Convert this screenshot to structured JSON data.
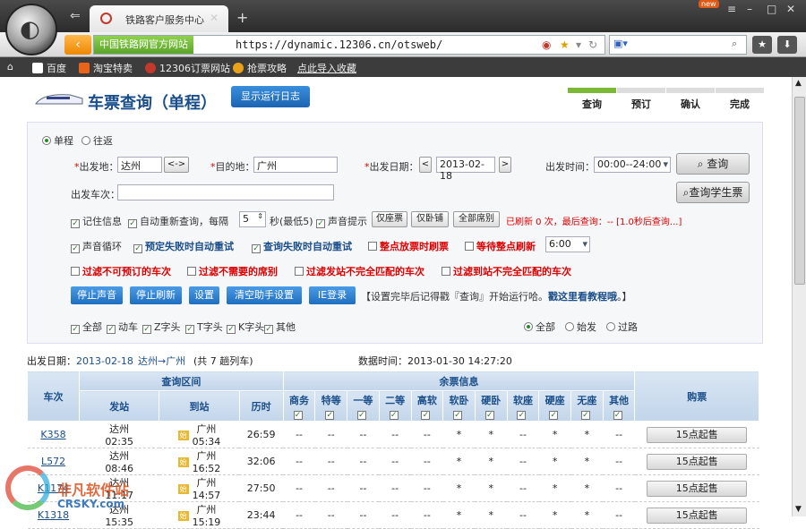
{
  "browser": {
    "tab_title": "铁路客户服务中心",
    "new_badge": "new",
    "site_badge": "中国铁路网官方网站",
    "url": "https://dynamic.12306.cn/otsweb/"
  },
  "bookmarks": [
    "百度",
    "淘宝特卖",
    "12306订票网站",
    "抢票攻略",
    "点此导入收藏"
  ],
  "header": {
    "title": "车票查询（单程）",
    "log_button": "显示运行日志",
    "steps": [
      "查询",
      "预订",
      "确认",
      "完成"
    ]
  },
  "form": {
    "trip_one": "单程",
    "trip_round": "往返",
    "from_label": "出发地：",
    "from_value": "达州",
    "swap": "<->",
    "to_label": "目的地：",
    "to_value": "广州",
    "date_label": "出发日期：",
    "date_prev": "<",
    "date_value": "2013-02-18",
    "date_next": ">",
    "time_label": "出发时间：",
    "time_value": "00:00--24:00",
    "query_btn": "查询",
    "student_btn": "查询学生票",
    "train_label": "出发车次：",
    "remember": "记住信息",
    "auto_requery": "自动重新查询，每隔",
    "interval": "5",
    "interval_unit": "秒(最低5)",
    "sound": "声音提示",
    "only_seat": "仅座票",
    "only_sleeper": "仅卧铺",
    "all_seat": "全部席别",
    "refresh_status": "已刷新 0 次，最后查询：-- [1.0秒后查询...]",
    "sound_loop": "声音循环",
    "auto_retry_book": "预定失败时自动重试",
    "auto_retry_query": "查询失败时自动重试",
    "whole_point": "整点放票时刷票",
    "wait_point": "等待整点刷新",
    "wait_time": "6:00",
    "filter1": "过滤不可预订的车次",
    "filter2": "过滤不需要的席别",
    "filter3": "过滤发站不完全匹配的车次",
    "filter4": "过滤到站不完全匹配的车次",
    "stop_sound": "停止声音",
    "stop_refresh": "停止刷新",
    "settings": "设置",
    "clear": "清空助手设置",
    "ie_login": "IE登录",
    "tip_prefix": "【设置完毕后记得戳『查询』开始运行哈。",
    "tip_link": "戳这里看教程哦",
    "tip_suffix": "。】",
    "types": [
      "全部",
      "动车",
      "Z字头",
      "T字头",
      "K字头",
      "其他"
    ],
    "station_all": "全部",
    "station_start": "始发",
    "station_pass": "过路"
  },
  "summary": {
    "date_label": "出发日期：",
    "date": "2013-02-18",
    "route": "达州→广州",
    "count_text": "(共 7 趟列车)",
    "data_time": "数据时间：2013-01-30 14:27:20"
  },
  "table": {
    "h_train": "车次",
    "h_range": "查询区间",
    "h_seats": "余票信息",
    "h_buy": "购票",
    "h_from": "发站",
    "h_to": "到站",
    "h_dur": "历时",
    "seat_cols": [
      "商务",
      "特等",
      "一等",
      "二等",
      "高软",
      "软卧",
      "硬卧",
      "软座",
      "硬座",
      "无座",
      "其他"
    ],
    "rows": [
      {
        "no": "K358",
        "from": "达州",
        "dep": "02:35",
        "to": "广州",
        "arr": "05:34",
        "dur": "26:59",
        "seats": [
          "--",
          "--",
          "--",
          "--",
          "--",
          "*",
          "*",
          "--",
          "*",
          "*",
          "--"
        ],
        "buy": "15点起售"
      },
      {
        "no": "L572",
        "from": "达州",
        "dep": "08:46",
        "to": "广州",
        "arr": "16:52",
        "dur": "32:06",
        "seats": [
          "--",
          "--",
          "--",
          "--",
          "--",
          "*",
          "*",
          "--",
          "*",
          "*",
          "--"
        ],
        "buy": "15点起售"
      },
      {
        "no": "K1174",
        "from": "达州",
        "dep": "11:17",
        "to": "广州",
        "arr": "14:57",
        "dur": "27:50",
        "seats": [
          "--",
          "--",
          "--",
          "--",
          "--",
          "*",
          "*",
          "--",
          "*",
          "*",
          "--"
        ],
        "buy": "15点起售"
      },
      {
        "no": "K1318",
        "from": "达州",
        "dep": "15:35",
        "to": "广州",
        "arr": "15:19",
        "dur": "23:44",
        "seats": [
          "--",
          "--",
          "--",
          "--",
          "--",
          "*",
          "*",
          "--",
          "*",
          "*",
          "--"
        ],
        "buy": "15点起售"
      }
    ],
    "start_tag": "始"
  },
  "watermark": {
    "cn": "非凡软件站",
    "en": "CRSKY.com"
  }
}
